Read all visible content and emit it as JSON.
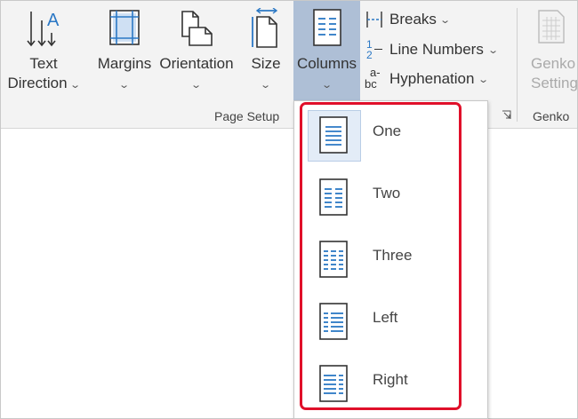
{
  "ribbon": {
    "text_direction": {
      "line1": "Text",
      "line2": "Direction",
      "icon": "text-direction-icon"
    },
    "margins": {
      "label": "Margins",
      "icon": "margins-icon"
    },
    "orientation": {
      "label": "Orientation",
      "icon": "orientation-icon"
    },
    "size": {
      "label": "Size",
      "icon": "size-icon"
    },
    "columns": {
      "label": "Columns",
      "icon": "columns-icon"
    },
    "breaks": {
      "label": "Breaks",
      "icon": "breaks-icon"
    },
    "line_numbers": {
      "label": "Line Numbers",
      "icon": "line-numbers-icon",
      "glyph_top": "1",
      "glyph_bottom": "2"
    },
    "hyphenation": {
      "label": "Hyphenation",
      "icon": "hyphenation-icon",
      "glyph_a": "a-",
      "glyph_bc": "bc"
    },
    "page_setup_group": "Page Setup",
    "genko": {
      "line1": "Genko",
      "line2": "Setting",
      "group": "Genko",
      "icon": "genko-icon"
    }
  },
  "columns_menu": {
    "items": [
      {
        "label": "One",
        "selected": true
      },
      {
        "label": "Two",
        "selected": false
      },
      {
        "label": "Three",
        "selected": false
      },
      {
        "label": "Left",
        "selected": false
      },
      {
        "label": "Right",
        "selected": false
      }
    ]
  },
  "colors": {
    "accent_blue": "#2b78c5",
    "highlight_red": "#e0102a",
    "active_button": "#aebfd6"
  }
}
